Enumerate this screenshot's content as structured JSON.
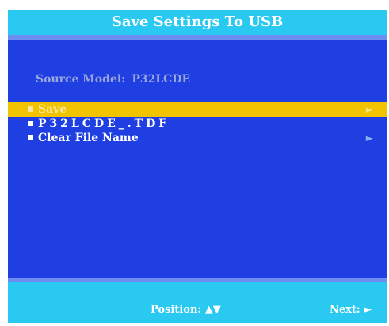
{
  "title": "Save Settings To USB",
  "source": {
    "label": "Source Model:",
    "value": "P32LCDE"
  },
  "menu": {
    "items": [
      {
        "label": "Save",
        "arrow": "►"
      },
      {
        "label": "P32LCDE_.TDF"
      },
      {
        "label": "Clear File Name",
        "arrow": "►"
      }
    ]
  },
  "footer": {
    "position_label": "Position: ▲▼",
    "next_label": "Next: ►"
  },
  "colors": {
    "background": "#1f3fe3",
    "bar": "#29c9f1",
    "highlight": "#f2c400"
  }
}
